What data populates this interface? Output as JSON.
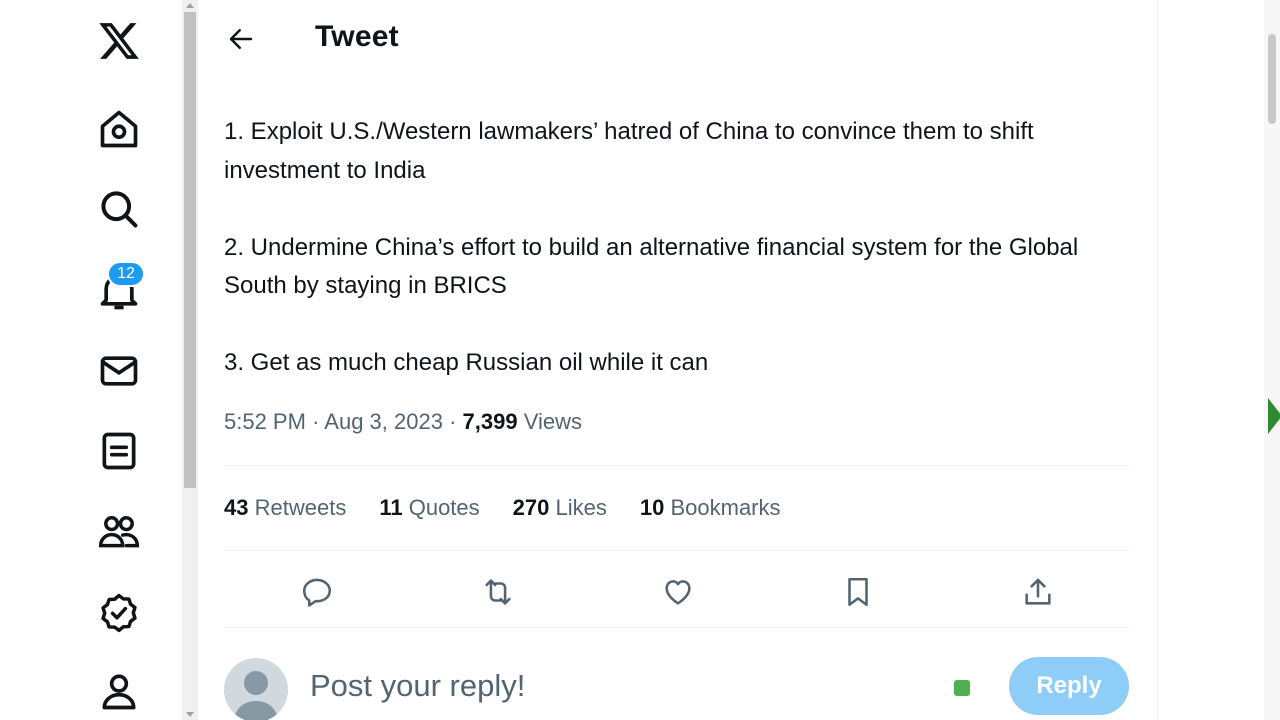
{
  "nav": {
    "items": [
      {
        "name": "x-logo-icon"
      },
      {
        "name": "home-icon"
      },
      {
        "name": "search-icon"
      },
      {
        "name": "notifications-icon"
      },
      {
        "name": "messages-icon"
      },
      {
        "name": "lists-icon"
      },
      {
        "name": "communities-icon"
      },
      {
        "name": "verified-icon"
      },
      {
        "name": "profile-icon"
      }
    ],
    "notifications_badge": "12"
  },
  "header": {
    "title": "Tweet"
  },
  "tweet": {
    "paragraphs": [
      "1. Exploit U.S./Western lawmakers’ hatred of China to convince them to shift investment to India",
      "2. Undermine China’s effort to build an alternative financial system for the Global South by staying in BRICS",
      "3. Get as much cheap Russian oil while it can"
    ],
    "time": "5:52 PM",
    "date": "Aug 3, 2023",
    "views_count": "7,399",
    "views_label": "Views"
  },
  "stats": {
    "retweets_count": "43",
    "retweets_label": "Retweets",
    "quotes_count": "11",
    "quotes_label": "Quotes",
    "likes_count": "270",
    "likes_label": "Likes",
    "bookmarks_count": "10",
    "bookmarks_label": "Bookmarks"
  },
  "reply": {
    "placeholder": "Post your reply!",
    "button_label": "Reply"
  },
  "colors": {
    "accent": "#1d9bf0",
    "reply_button": "#8ecdf8",
    "secondary_text": "#536471",
    "primary_text": "#0f1419"
  }
}
